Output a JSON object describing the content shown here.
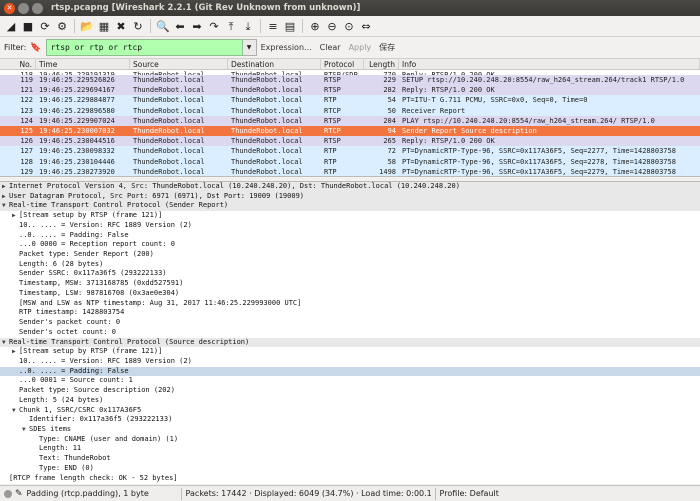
{
  "window": {
    "title": "rtsp.pcapng [Wireshark 2.2.1 (Git Rev Unknown from unknown)]"
  },
  "toolbar": {
    "icons": [
      "shark-fin-start-icon",
      "stop-icon",
      "restart-icon",
      "options-gear-icon",
      "open-folder-icon",
      "save-icon",
      "close-file-icon",
      "reload-icon",
      "find-icon",
      "back-arrow-icon",
      "forward-arrow-icon",
      "goto-packet-icon",
      "go-first-icon",
      "go-last-icon",
      "autoscroll-icon",
      "colorize-icon",
      "zoom-in-icon",
      "zoom-out-icon",
      "normal-size-icon",
      "resize-columns-icon"
    ],
    "glyphs": [
      "◢",
      "■",
      "⟳",
      "⚙",
      "📂",
      "▦",
      "✖",
      "↻",
      "🔍",
      "⬅",
      "➡",
      "↷",
      "⤒",
      "⤓",
      "≡",
      "▤",
      "⊕",
      "⊖",
      "⊙",
      "⇔"
    ]
  },
  "filter": {
    "label": "Filter:",
    "value": "rtsp or rtp or rtcp",
    "expression_label": "Expression...",
    "clear_label": "Clear",
    "apply_label": "Apply",
    "save_label": "保存"
  },
  "packet_list": {
    "columns": [
      "No.",
      "Time",
      "Source",
      "Destination",
      "Protocol",
      "Length",
      "Info"
    ],
    "rows": [
      {
        "no": "118",
        "time": "19:46:25.229191319",
        "src": "ThundeRobot.local",
        "dst": "ThundeRobot.local",
        "proto": "RTSP/SDP",
        "len": "770",
        "info": "Reply: RTSP/1.0 200 OK",
        "kind": "partial"
      },
      {
        "no": "119",
        "time": "19:46:25.229526826",
        "src": "ThundeRobot.local",
        "dst": "ThundeRobot.local",
        "proto": "RTSP",
        "len": "229",
        "info": "SETUP rtsp://10.240.248.20:8554/raw_h264_stream.264/track1 RTSP/1.0",
        "kind": "rtsp"
      },
      {
        "no": "121",
        "time": "19:46:25.229694167",
        "src": "ThundeRobot.local",
        "dst": "ThundeRobot.local",
        "proto": "RTSP",
        "len": "282",
        "info": "Reply: RTSP/1.0 200 OK",
        "kind": "rtsp"
      },
      {
        "no": "122",
        "time": "19:46:25.229884877",
        "src": "ThundeRobot.local",
        "dst": "ThundeRobot.local",
        "proto": "RTP",
        "len": "54",
        "info": "PT=ITU-T G.711 PCMU, SSRC=0x0, Seq=0, Time=0",
        "kind": "rtp"
      },
      {
        "no": "123",
        "time": "19:46:25.229896580",
        "src": "ThundeRobot.local",
        "dst": "ThundeRobot.local",
        "proto": "RTCP",
        "len": "50",
        "info": "Receiver Report",
        "kind": "rtp"
      },
      {
        "no": "124",
        "time": "19:46:25.229907024",
        "src": "ThundeRobot.local",
        "dst": "ThundeRobot.local",
        "proto": "RTSP",
        "len": "204",
        "info": "PLAY rtsp://10.240.248.20:8554/raw_h264_stream.264/ RTSP/1.0",
        "kind": "rtsp"
      },
      {
        "no": "125",
        "time": "19:46:25.230007032",
        "src": "ThundeRobot.local",
        "dst": "ThundeRobot.local",
        "proto": "RTCP",
        "len": "94",
        "info": "Sender Report   Source description",
        "kind": "sel"
      },
      {
        "no": "126",
        "time": "19:46:25.230044516",
        "src": "ThundeRobot.local",
        "dst": "ThundeRobot.local",
        "proto": "RTSP",
        "len": "265",
        "info": "Reply: RTSP/1.0 200 OK",
        "kind": "rtsp"
      },
      {
        "no": "127",
        "time": "19:46:25.230098332",
        "src": "ThundeRobot.local",
        "dst": "ThundeRobot.local",
        "proto": "RTP",
        "len": "72",
        "info": "PT=DynamicRTP-Type-96, SSRC=0x117A36F5, Seq=2277, Time=1428803758",
        "kind": "rtp"
      },
      {
        "no": "128",
        "time": "19:46:25.230104446",
        "src": "ThundeRobot.local",
        "dst": "ThundeRobot.local",
        "proto": "RTP",
        "len": "58",
        "info": "PT=DynamicRTP-Type-96, SSRC=0x117A36F5, Seq=2278, Time=1428803758",
        "kind": "rtp"
      },
      {
        "no": "129",
        "time": "19:46:25.230273920",
        "src": "ThundeRobot.local",
        "dst": "ThundeRobot.local",
        "proto": "RTP",
        "len": "1498",
        "info": "PT=DynamicRTP-Type-96, SSRC=0x117A36F5, Seq=2279, Time=1428803758",
        "kind": "rtp"
      }
    ]
  },
  "details": {
    "rows": [
      {
        "text": "Internet Protocol Version 4, Src: ThundeRobot.local (10.240.248.20), Dst: ThundeRobot.local (10.240.248.20)",
        "indent": 0,
        "toggle": "▶",
        "kind": "hdr"
      },
      {
        "text": "User Datagram Protocol, Src Port: 6971 (6971), Dst Port: 19009 (19009)",
        "indent": 0,
        "toggle": "▶",
        "kind": "hdr"
      },
      {
        "text": "Real-time Transport Control Protocol (Sender Report)",
        "indent": 0,
        "toggle": "▼",
        "kind": "hdr"
      },
      {
        "text": "[Stream setup by RTSP (frame 121)]",
        "indent": 1,
        "toggle": "▶",
        "kind": ""
      },
      {
        "text": "10.. .... = Version: RFC 1889 Version (2)",
        "indent": 1,
        "toggle": "",
        "kind": ""
      },
      {
        "text": "..0. .... = Padding: False",
        "indent": 1,
        "toggle": "",
        "kind": ""
      },
      {
        "text": "...0 0000 = Reception report count: 0",
        "indent": 1,
        "toggle": "",
        "kind": ""
      },
      {
        "text": "Packet type: Sender Report (200)",
        "indent": 1,
        "toggle": "",
        "kind": ""
      },
      {
        "text": "Length: 6 (28 bytes)",
        "indent": 1,
        "toggle": "",
        "kind": ""
      },
      {
        "text": "Sender SSRC: 0x117a36f5 (293222133)",
        "indent": 1,
        "toggle": "",
        "kind": ""
      },
      {
        "text": "Timestamp, MSW: 3713168785 (0xdd527591)",
        "indent": 1,
        "toggle": "",
        "kind": ""
      },
      {
        "text": "Timestamp, LSW: 987816708 (0x3ae0e304)",
        "indent": 1,
        "toggle": "",
        "kind": ""
      },
      {
        "text": "[MSW and LSW as NTP timestamp: Aug 31, 2017 11:46:25.229993000 UTC]",
        "indent": 1,
        "toggle": "",
        "kind": ""
      },
      {
        "text": "RTP timestamp: 1428803754",
        "indent": 1,
        "toggle": "",
        "kind": ""
      },
      {
        "text": "Sender's packet count: 0",
        "indent": 1,
        "toggle": "",
        "kind": ""
      },
      {
        "text": "Sender's octet count: 0",
        "indent": 1,
        "toggle": "",
        "kind": ""
      },
      {
        "text": "Real-time Transport Control Protocol (Source description)",
        "indent": 0,
        "toggle": "▼",
        "kind": "hdr"
      },
      {
        "text": "[Stream setup by RTSP (frame 121)]",
        "indent": 1,
        "toggle": "▶",
        "kind": ""
      },
      {
        "text": "10.. .... = Version: RFC 1889 Version (2)",
        "indent": 1,
        "toggle": "",
        "kind": ""
      },
      {
        "text": "..0. .... = Padding: False",
        "indent": 1,
        "toggle": "",
        "kind": "hl"
      },
      {
        "text": "...0 0001 = Source count: 1",
        "indent": 1,
        "toggle": "",
        "kind": ""
      },
      {
        "text": "Packet type: Source description (202)",
        "indent": 1,
        "toggle": "",
        "kind": ""
      },
      {
        "text": "Length: 5 (24 bytes)",
        "indent": 1,
        "toggle": "",
        "kind": ""
      },
      {
        "text": "Chunk 1, SSRC/CSRC 0x117A36F5",
        "indent": 1,
        "toggle": "▼",
        "kind": ""
      },
      {
        "text": "Identifier: 0x117a36f5 (293222133)",
        "indent": 2,
        "toggle": "",
        "kind": ""
      },
      {
        "text": "SDES items",
        "indent": 2,
        "toggle": "▼",
        "kind": ""
      },
      {
        "text": "Type: CNAME (user and domain) (1)",
        "indent": 3,
        "toggle": "",
        "kind": ""
      },
      {
        "text": "Length: 11",
        "indent": 3,
        "toggle": "",
        "kind": ""
      },
      {
        "text": "Text: ThundeRobot",
        "indent": 3,
        "toggle": "",
        "kind": ""
      },
      {
        "text": "Type: END (0)",
        "indent": 3,
        "toggle": "",
        "kind": ""
      },
      {
        "text": "[RTCP frame length check: OK - 52 bytes]",
        "indent": 0,
        "toggle": "",
        "kind": ""
      }
    ]
  },
  "status": {
    "field_text": "Padding (rtcp.padding), 1 byte",
    "stats_text": "Packets: 17442 · Displayed: 6049 (34.7%) · Load time: 0:00.172",
    "profile_text": "Profile: Default"
  }
}
